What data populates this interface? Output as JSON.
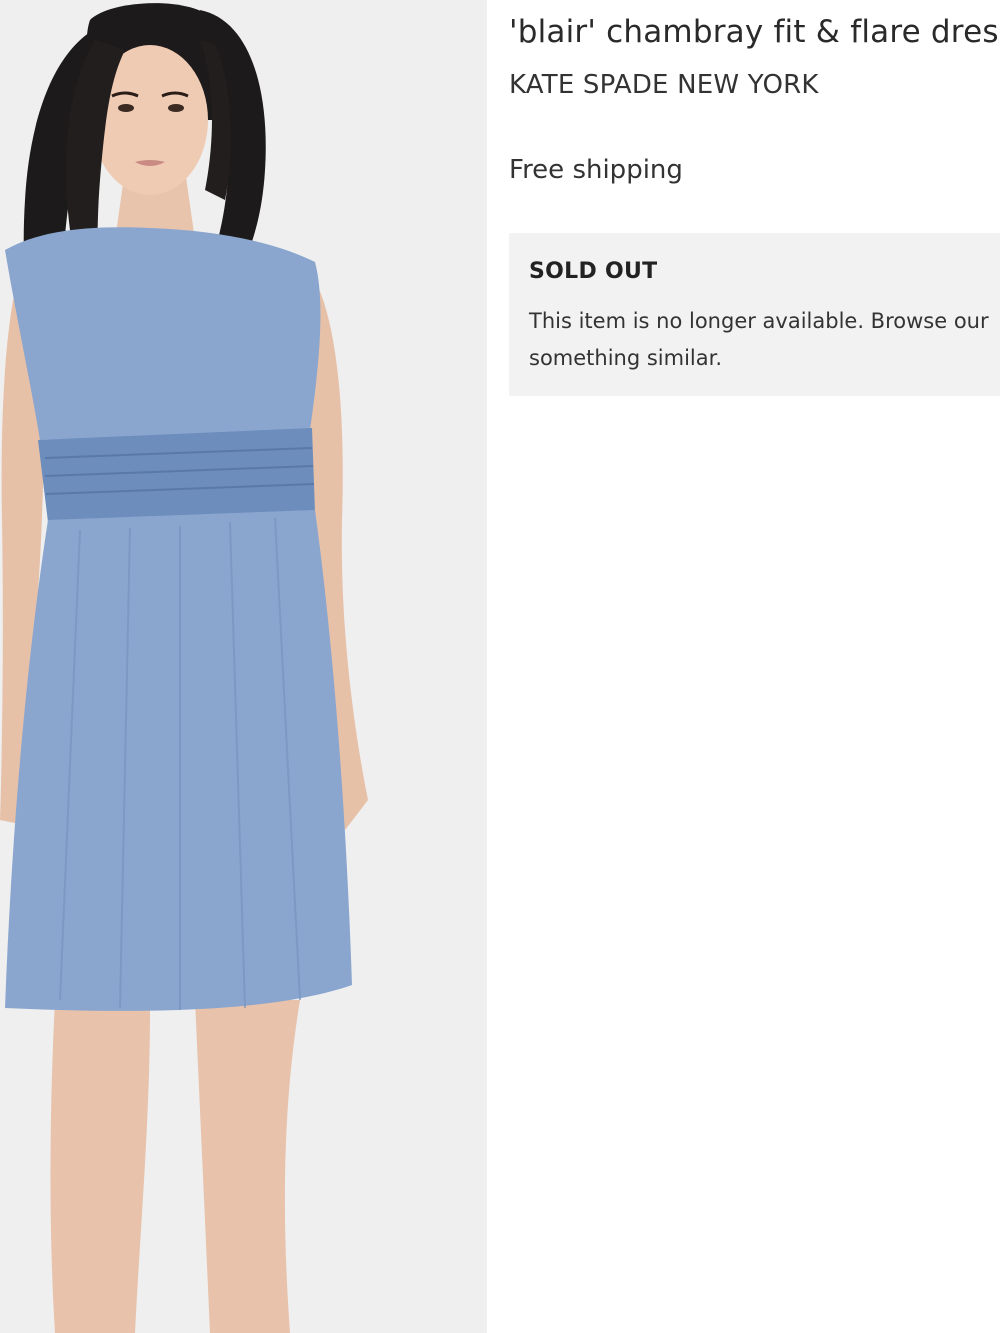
{
  "product": {
    "title": "'blair' chambray fit & flare dress",
    "brand": "KATE SPADE NEW YORK",
    "shipping": "Free shipping",
    "image_icon": "product-photo-model-in-blue-chambray-dress"
  },
  "availability": {
    "status": "SOLD OUT",
    "message": "This item is no longer available. Browse our something similar."
  },
  "colors": {
    "background": "#ffffff",
    "photo_background": "#efefef",
    "notice_background": "#f2f2f2",
    "dress": "#8aa6cf",
    "text": "#2b2b2b"
  }
}
